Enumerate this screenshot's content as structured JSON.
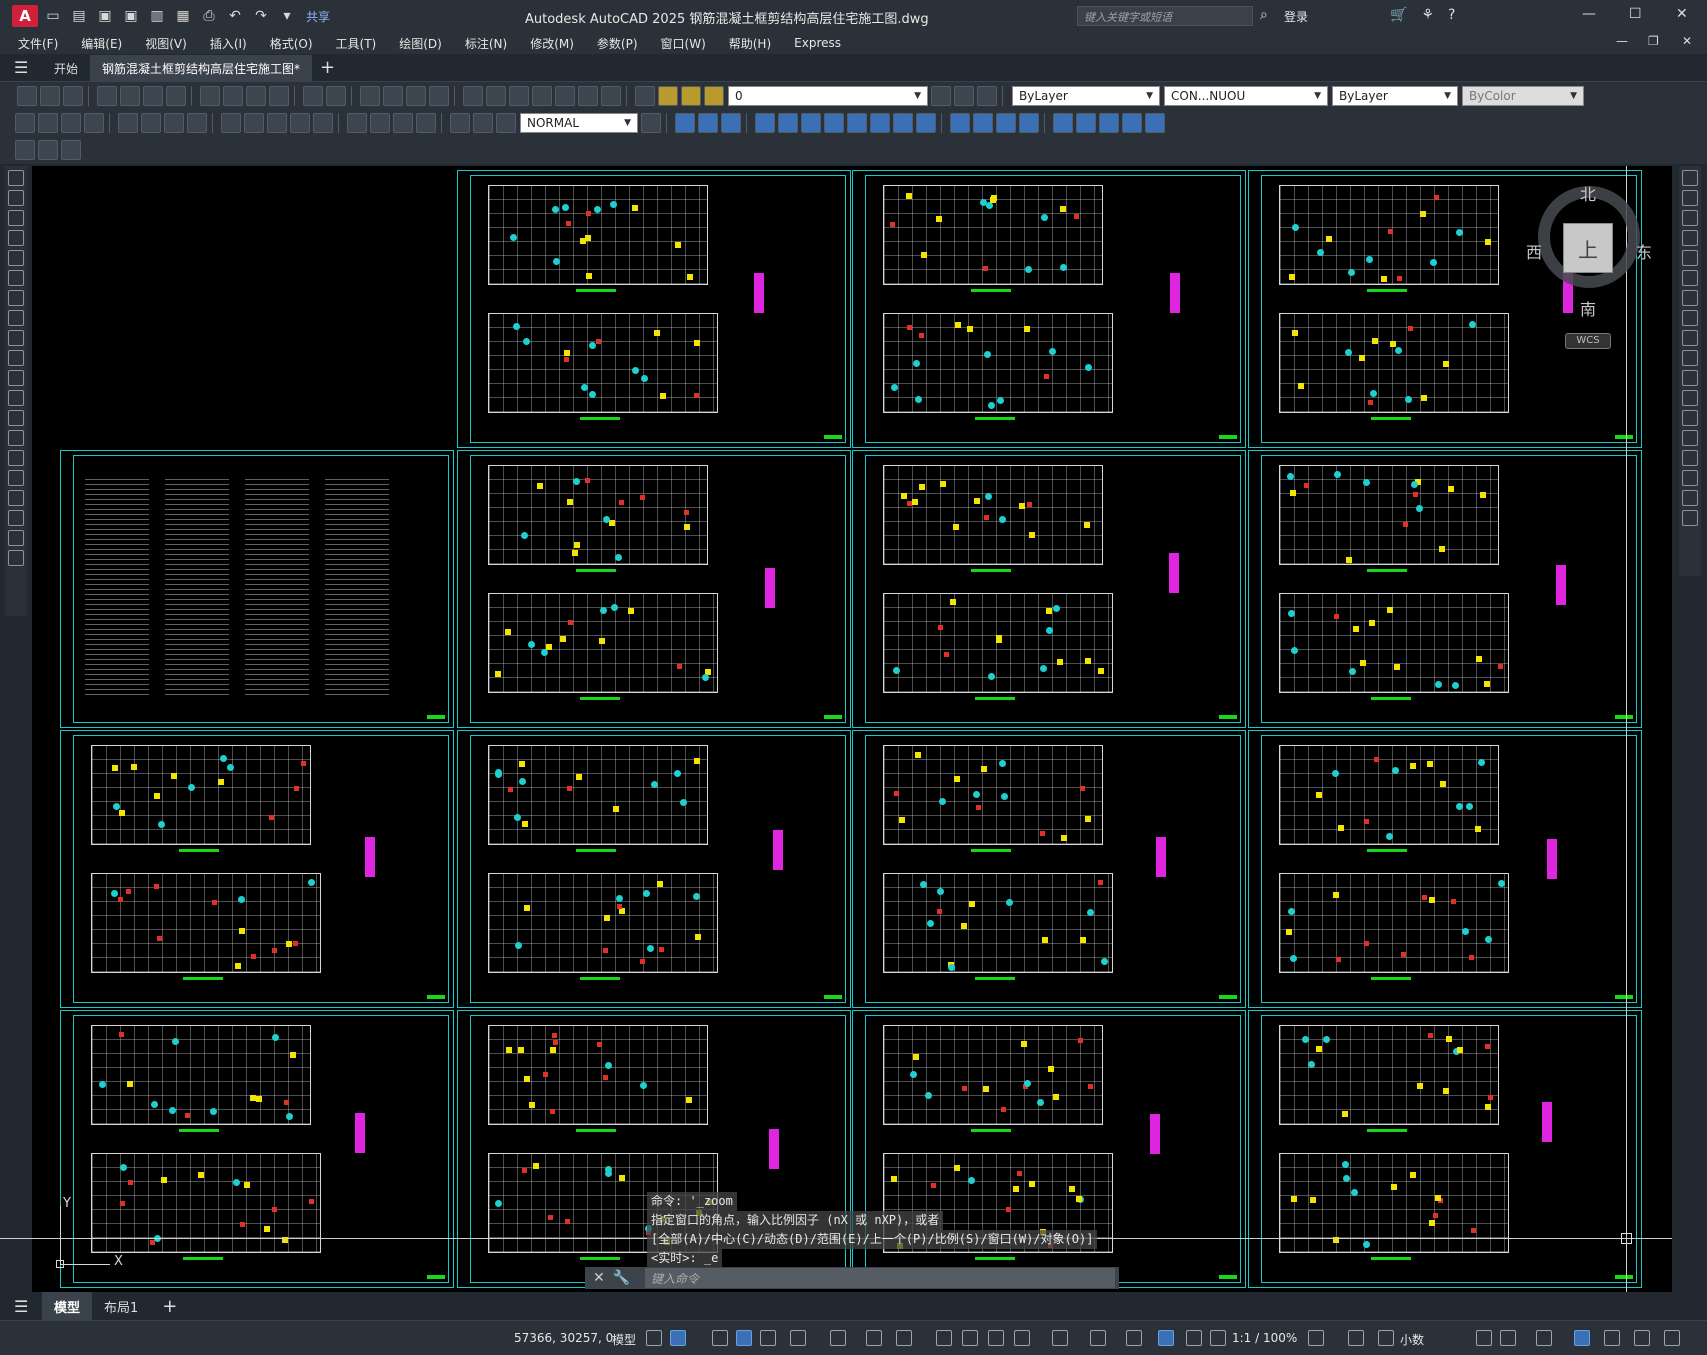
{
  "app": {
    "logo": "A",
    "title": "Autodesk AutoCAD 2025    钢筋混凝土框剪结构高层住宅施工图.dwg",
    "search_placeholder": "键入关键字或短语",
    "login_label": "登录",
    "share_label": "共享"
  },
  "menu": {
    "items": [
      "文件(F)",
      "编辑(E)",
      "视图(V)",
      "插入(I)",
      "格式(O)",
      "工具(T)",
      "绘图(D)",
      "标注(N)",
      "修改(M)",
      "参数(P)",
      "窗口(W)",
      "帮助(H)",
      "Express"
    ]
  },
  "tabs": {
    "start": "开始",
    "active_file": "钢筋混凝土框剪结构高层住宅施工图*",
    "add": "+"
  },
  "toolbar": {
    "text_style": "NORMAL",
    "layer": "0",
    "color": "ByLayer",
    "linetype": "CON...NUOU",
    "lineweight": "ByLayer",
    "plotstyle": "ByColor"
  },
  "viewcube": {
    "north": "北",
    "south": "南",
    "east": "东",
    "west": "西",
    "top": "上",
    "wcs": "WCS"
  },
  "ucs": {
    "x": "X",
    "y": "Y"
  },
  "command": {
    "history": [
      "命令: '_zoom",
      "指定窗口的角点，输入比例因子 (nX 或 nXP)，或者",
      "[全部(A)/中心(C)/动态(D)/范围(E)/上一个(P)/比例(S)/窗口(W)/对象(O)]",
      "<实时>: _e"
    ],
    "placeholder": "键入命令"
  },
  "layout_tabs": {
    "model": "模型",
    "layout1": "布局1",
    "add": "+"
  },
  "status": {
    "coords": "57366, 30257, 0",
    "model": "模型",
    "scale": "1:1 / 100%",
    "units": "小数"
  }
}
